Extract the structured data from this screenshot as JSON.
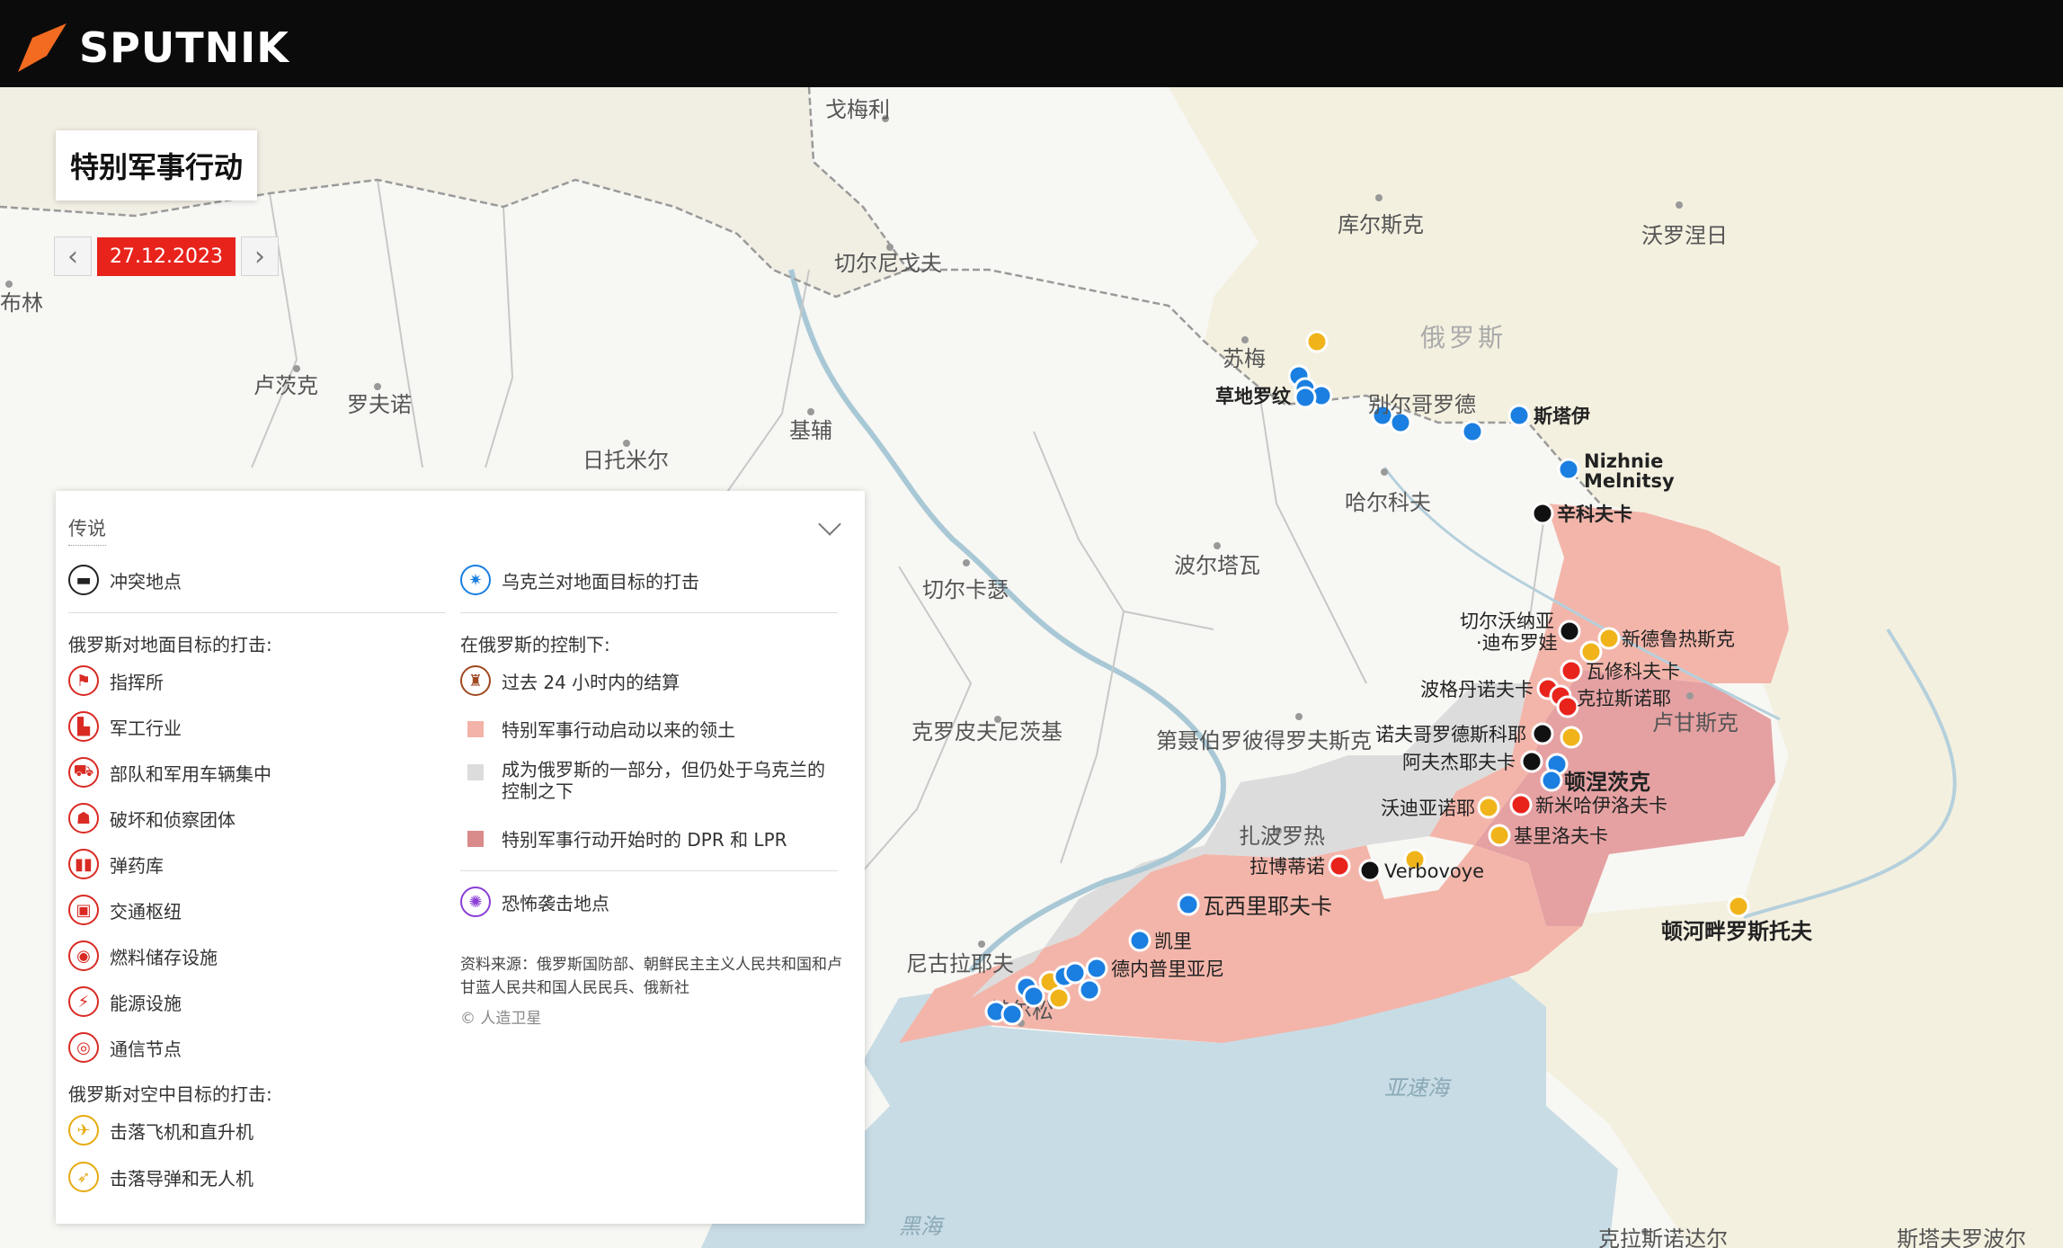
{
  "brand": {
    "name": "SPUTNIK"
  },
  "title": "特别军事行动",
  "date": {
    "value": "27.12.2023",
    "prev_label": "‹",
    "next_label": "›"
  },
  "colors": {
    "red_strike": "#e8231c",
    "blue_strike": "#1a7fe0",
    "yellow": "#f0b41a",
    "black": "#111111",
    "controlled_new": "#f3b3a8",
    "disputed": "#dcdcdc",
    "original_dpr_lpr": "#e49a9a",
    "russia": "#f3efe0",
    "ukraine": "#f8f8f6",
    "sea": "#c9dde6"
  },
  "legend": {
    "header": "传说",
    "conflict": "冲突地点",
    "ua_strikes": "乌克兰对地面目标的打击",
    "ru_ground_header": "俄罗斯对地面目标的打击:",
    "ru_ground": [
      {
        "label": "指挥所",
        "icon": "flag-icon"
      },
      {
        "label": "军工行业",
        "icon": "factory-icon"
      },
      {
        "label": "部队和军用车辆集中",
        "icon": "truck-icon"
      },
      {
        "label": "破坏和侦察团体",
        "icon": "group-icon"
      },
      {
        "label": "弹药库",
        "icon": "ammo-icon"
      },
      {
        "label": "交通枢纽",
        "icon": "train-icon"
      },
      {
        "label": "燃料储存设施",
        "icon": "fuel-icon"
      },
      {
        "label": "能源设施",
        "icon": "energy-icon"
      },
      {
        "label": "通信节点",
        "icon": "antenna-icon"
      }
    ],
    "ru_air_header": "俄罗斯对空中目标的打击:",
    "ru_air": [
      {
        "label": "击落飞机和直升机",
        "icon": "aircraft-icon"
      },
      {
        "label": "击落导弹和无人机",
        "icon": "missile-icon"
      }
    ],
    "control_header": "在俄罗斯的控制下:",
    "control": [
      {
        "label": "过去 24 小时内的结算",
        "kind": "icon"
      },
      {
        "label": "特别军事行动启动以来的领土",
        "kind": "square",
        "color": "#f3b3a8"
      },
      {
        "label": "成为俄罗斯的一部分，但仍处于乌克兰的控制之下",
        "kind": "square",
        "color": "#dcdcdc"
      },
      {
        "label": "特别军事行动开始时的 DPR 和 LPR",
        "kind": "square",
        "color": "#d98a8a"
      }
    ],
    "terror": "恐怖袭击地点",
    "source": "资料来源：俄罗斯国防部、朝鲜民主主义人民共和国和卢甘蓝人民共和国人民民兵、俄新社",
    "copyright": "© 人造卫星"
  },
  "places": [
    {
      "name": "戈梅利"
    },
    {
      "name": "布林"
    },
    {
      "name": "卢茨克"
    },
    {
      "name": "罗夫诺"
    },
    {
      "name": "日托米尔"
    },
    {
      "name": "基辅"
    },
    {
      "name": "切尔尼戈夫"
    },
    {
      "name": "库尔斯克"
    },
    {
      "name": "沃罗涅日"
    },
    {
      "name": "俄罗斯"
    },
    {
      "name": "苏梅"
    },
    {
      "name": "哈尔科夫"
    },
    {
      "name": "波尔塔瓦"
    },
    {
      "name": "切尔卡瑟"
    },
    {
      "name": "克罗皮夫尼茨基"
    },
    {
      "name": "第聂伯罗彼得罗夫斯克"
    },
    {
      "name": "扎波罗热"
    },
    {
      "name": "尼古拉耶夫"
    },
    {
      "name": "赫尔松"
    },
    {
      "name": "卢甘斯克"
    },
    {
      "name": "顿河畔罗斯托夫"
    },
    {
      "name": "亚速海"
    },
    {
      "name": "黑海"
    },
    {
      "name": "克拉斯诺达尔"
    },
    {
      "name": "斯塔夫罗波尔"
    },
    {
      "name": "沃罗涅日"
    }
  ],
  "markers": [
    {
      "name": "草地罗纹",
      "color": "blue"
    },
    {
      "name": "别尔哥罗德",
      "color": "blue"
    },
    {
      "name": "斯塔伊",
      "color": "blue"
    },
    {
      "name": "Nizhnie Melnitsy",
      "color": "blue"
    },
    {
      "name": "辛科夫卡",
      "color": "black"
    },
    {
      "name": "切尔沃纳亚 ·迪布罗娃",
      "color": "black"
    },
    {
      "name": "新德鲁热斯克",
      "color": "yellow"
    },
    {
      "name": "瓦修科夫卡",
      "color": "red"
    },
    {
      "name": "波格丹诺夫卡",
      "color": "red"
    },
    {
      "name": "克拉斯诺耶",
      "color": "red"
    },
    {
      "name": "诺夫哥罗德斯科耶",
      "color": "black"
    },
    {
      "name": "阿夫杰耶夫卡",
      "color": "black"
    },
    {
      "name": "顿涅茨克",
      "color": "blue"
    },
    {
      "name": "沃迪亚诺耶",
      "color": "yellow"
    },
    {
      "name": "新米哈伊洛夫卡",
      "color": "red"
    },
    {
      "name": "基里洛夫卡",
      "color": "yellow"
    },
    {
      "name": "拉博蒂诺",
      "color": "red"
    },
    {
      "name": "Verbovoye",
      "color": "black"
    },
    {
      "name": "瓦西里耶夫卡",
      "color": "blue"
    },
    {
      "name": "凯里",
      "color": "blue"
    },
    {
      "name": "德内普里亚尼",
      "color": "blue"
    },
    {
      "name": "顿河畔罗斯托夫",
      "color": "yellow"
    }
  ]
}
